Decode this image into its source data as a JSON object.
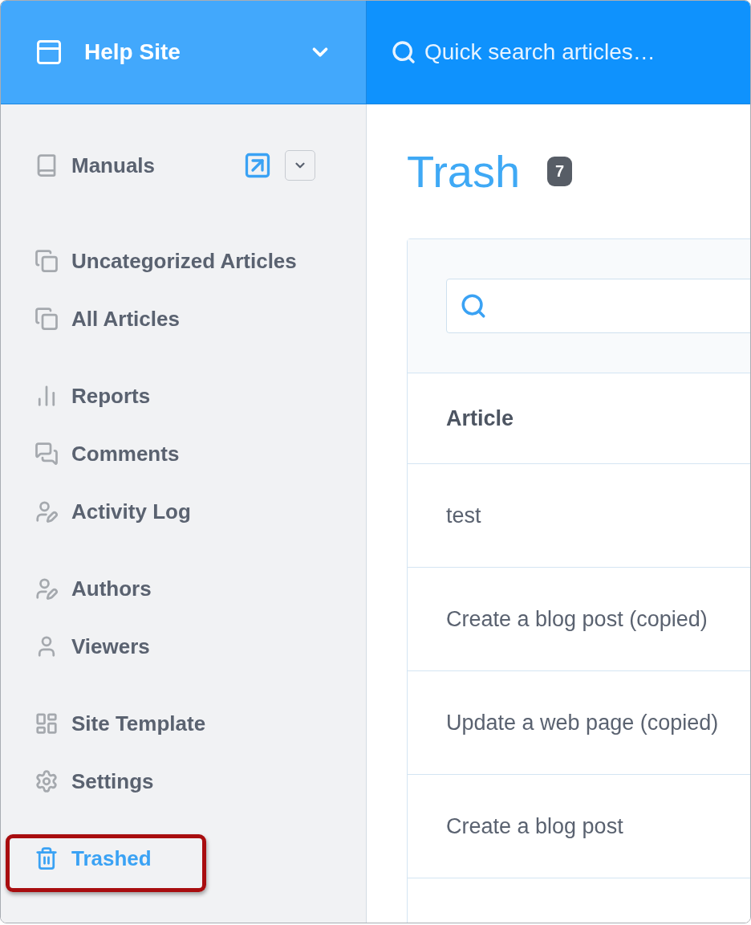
{
  "header": {
    "site_name": "Help Site",
    "search_placeholder": "Quick search articles…"
  },
  "sidebar": {
    "groups": [
      [
        {
          "label": "Manuals",
          "kind": "manual",
          "selected": false,
          "highlighted": false
        }
      ],
      [
        {
          "label": "Uncategorized Articles",
          "kind": "link",
          "selected": false,
          "highlighted": false
        },
        {
          "label": "All Articles",
          "kind": "link",
          "selected": false,
          "highlighted": false
        }
      ],
      [
        {
          "label": "Reports",
          "kind": "link",
          "selected": false,
          "highlighted": false
        },
        {
          "label": "Comments",
          "kind": "link",
          "selected": false,
          "highlighted": false
        },
        {
          "label": "Activity Log",
          "kind": "link",
          "selected": false,
          "highlighted": false
        }
      ],
      [
        {
          "label": "Authors",
          "kind": "link",
          "selected": false,
          "highlighted": false
        },
        {
          "label": "Viewers",
          "kind": "link",
          "selected": false,
          "highlighted": false
        }
      ],
      [
        {
          "label": "Site Template",
          "kind": "link",
          "selected": false,
          "highlighted": false
        },
        {
          "label": "Settings",
          "kind": "link",
          "selected": false,
          "highlighted": false
        }
      ],
      [
        {
          "label": "Trashed",
          "kind": "link",
          "selected": true,
          "highlighted": true
        }
      ]
    ]
  },
  "page": {
    "title": "Trash",
    "count": "7"
  },
  "table": {
    "columns": [
      "Article"
    ],
    "rows": [
      {
        "article": "test"
      },
      {
        "article": "Create a blog post (copied)"
      },
      {
        "article": "Update a web page (copied)"
      },
      {
        "article": "Create a blog post"
      }
    ]
  }
}
